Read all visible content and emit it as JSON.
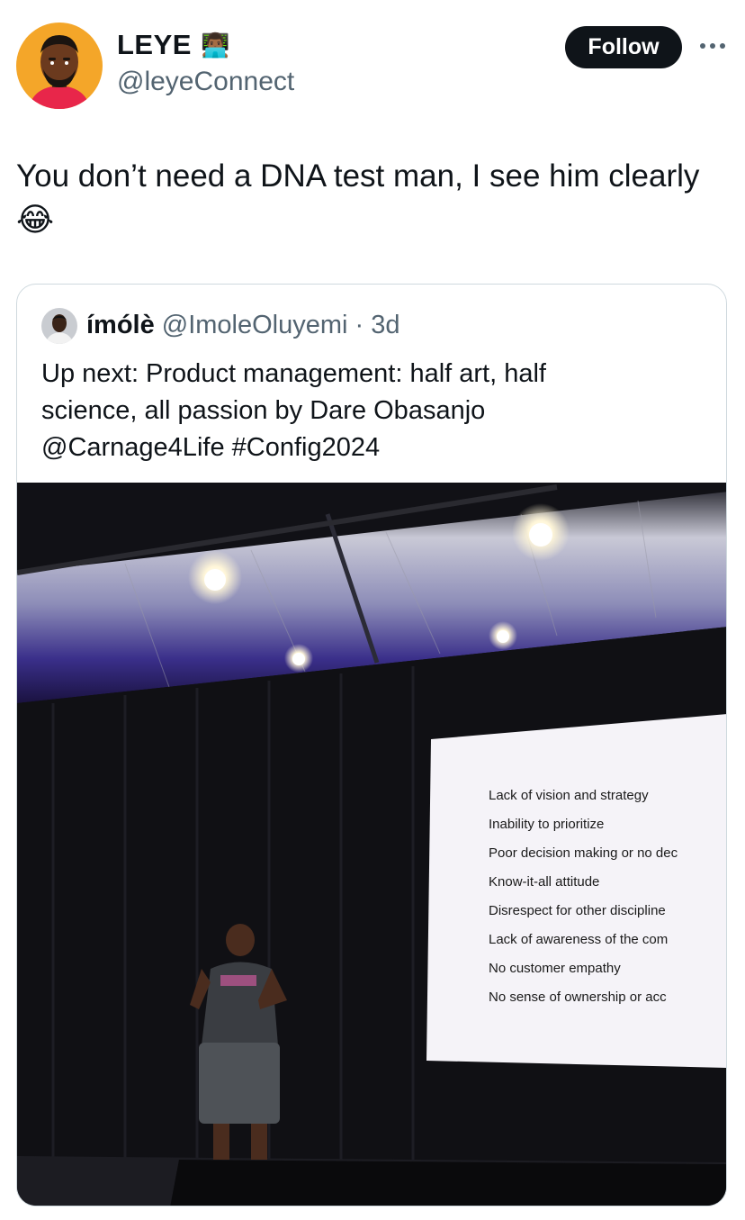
{
  "author": {
    "name": "LEYE",
    "name_emoji": "👨🏾‍💻",
    "handle": "@leyeConnect",
    "avatar": "cartoon-man-avatar"
  },
  "follow_button": {
    "label": "Follow"
  },
  "more_icon": "more-horizontal-icon",
  "tweet": {
    "text": "You don’t need a DNA test man, I see him clearly",
    "emoji": "😂"
  },
  "quote": {
    "name": "ímólè",
    "handle": "@ImoleOluyemi",
    "time": "3d",
    "text_line1": "Up next: Product management: half art, half",
    "text_line2": "science, all passion by Dare Obasanjo",
    "text_line3": "@Carnage4Life #Config2024",
    "slide_items": [
      "Lack of vision and strategy",
      "Inability to prioritize",
      "Poor decision making or no dec",
      "Know-it-all attitude",
      "Disrespect for other discipline",
      "Lack of awareness of the com",
      "No customer empathy",
      "No sense of ownership or acc"
    ]
  },
  "colors": {
    "text": "#0f1419",
    "secondary": "#536471",
    "button_bg": "#0f1419",
    "border": "#cfd9de"
  }
}
